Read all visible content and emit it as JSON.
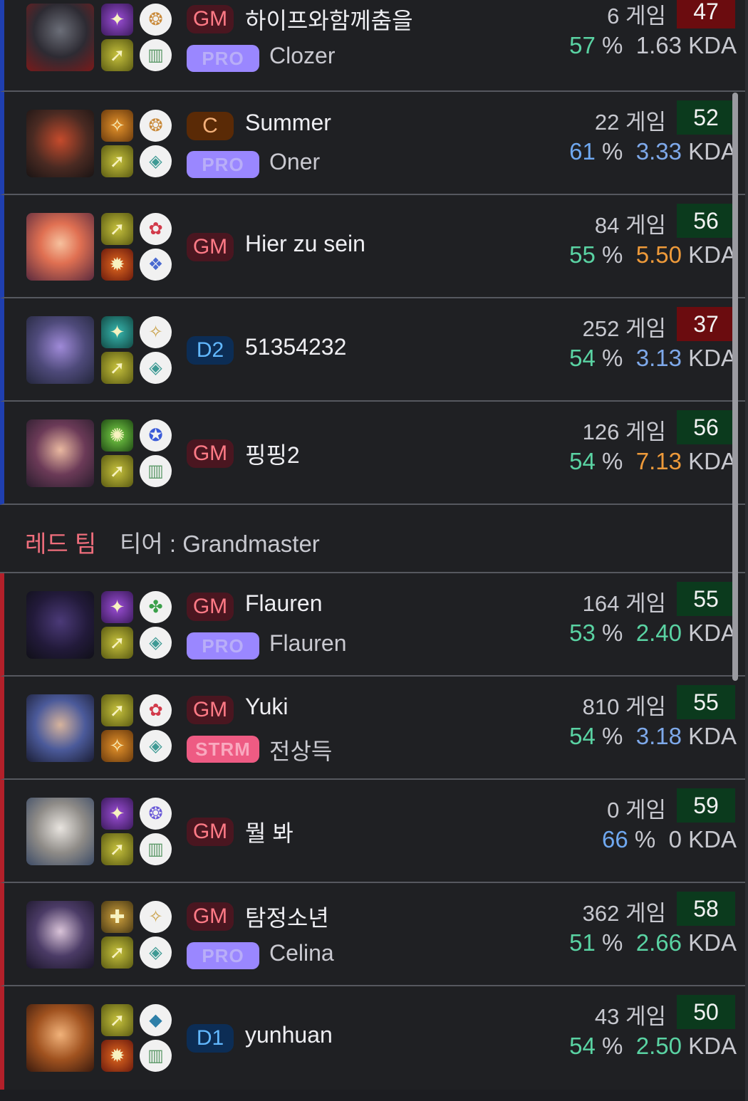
{
  "blue_rows": [
    {
      "tier": "GM",
      "name": "하이프와함께춤을",
      "pro": "PRO",
      "pro_name": "Clozer",
      "games": "6 게임",
      "score": "47",
      "pct": "57",
      "kda": "1.63"
    },
    {
      "tier": "C",
      "name": "Summer",
      "pro": "PRO",
      "pro_name": "Oner",
      "games": "22 게임",
      "score": "52",
      "pct": "61",
      "kda": "3.33"
    },
    {
      "tier": "GM",
      "name": "Hier zu sein",
      "games": "84 게임",
      "score": "56",
      "pct": "55",
      "kda": "5.50"
    },
    {
      "tier": "D2",
      "name": "51354232",
      "games": "252 게임",
      "score": "37",
      "pct": "54",
      "kda": "3.13"
    },
    {
      "tier": "GM",
      "name": "핑핑2",
      "games": "126 게임",
      "score": "56",
      "pct": "54",
      "kda": "7.13"
    }
  ],
  "red_header": {
    "team": "레드 팀",
    "tier_label": "티어 : Grandmaster"
  },
  "red_rows": [
    {
      "tier": "GM",
      "name": "Flauren",
      "pro": "PRO",
      "pro_name": "Flauren",
      "games": "164 게임",
      "score": "55",
      "pct": "53",
      "kda": "2.40"
    },
    {
      "tier": "GM",
      "name": "Yuki",
      "pro": "STRM",
      "pro_name": "전상득",
      "games": "810 게임",
      "score": "55",
      "pct": "54",
      "kda": "3.18"
    },
    {
      "tier": "GM",
      "name": "뭘 봐",
      "games": "0 게임",
      "score": "59",
      "pct": "66",
      "kda": "0"
    },
    {
      "tier": "GM",
      "name": "탐정소년",
      "pro": "PRO",
      "pro_name": "Celina",
      "games": "362 게임",
      "score": "58",
      "pct": "51",
      "kda": "2.66"
    },
    {
      "tier": "D1",
      "name": "yunhuan",
      "games": "43 게임",
      "score": "50",
      "pct": "54",
      "kda": "2.50"
    }
  ],
  "labels": {
    "pct_sign": "%",
    "kda_suffix": "KDA"
  },
  "colors": {
    "blue_team": "#1f3fb0",
    "red_team": "#b3202a",
    "score_bad": "#6b0c0f",
    "score_good": "#0b3a1d",
    "pro_badge": "#9a87ff",
    "strm_badge": "#ee5b83"
  }
}
